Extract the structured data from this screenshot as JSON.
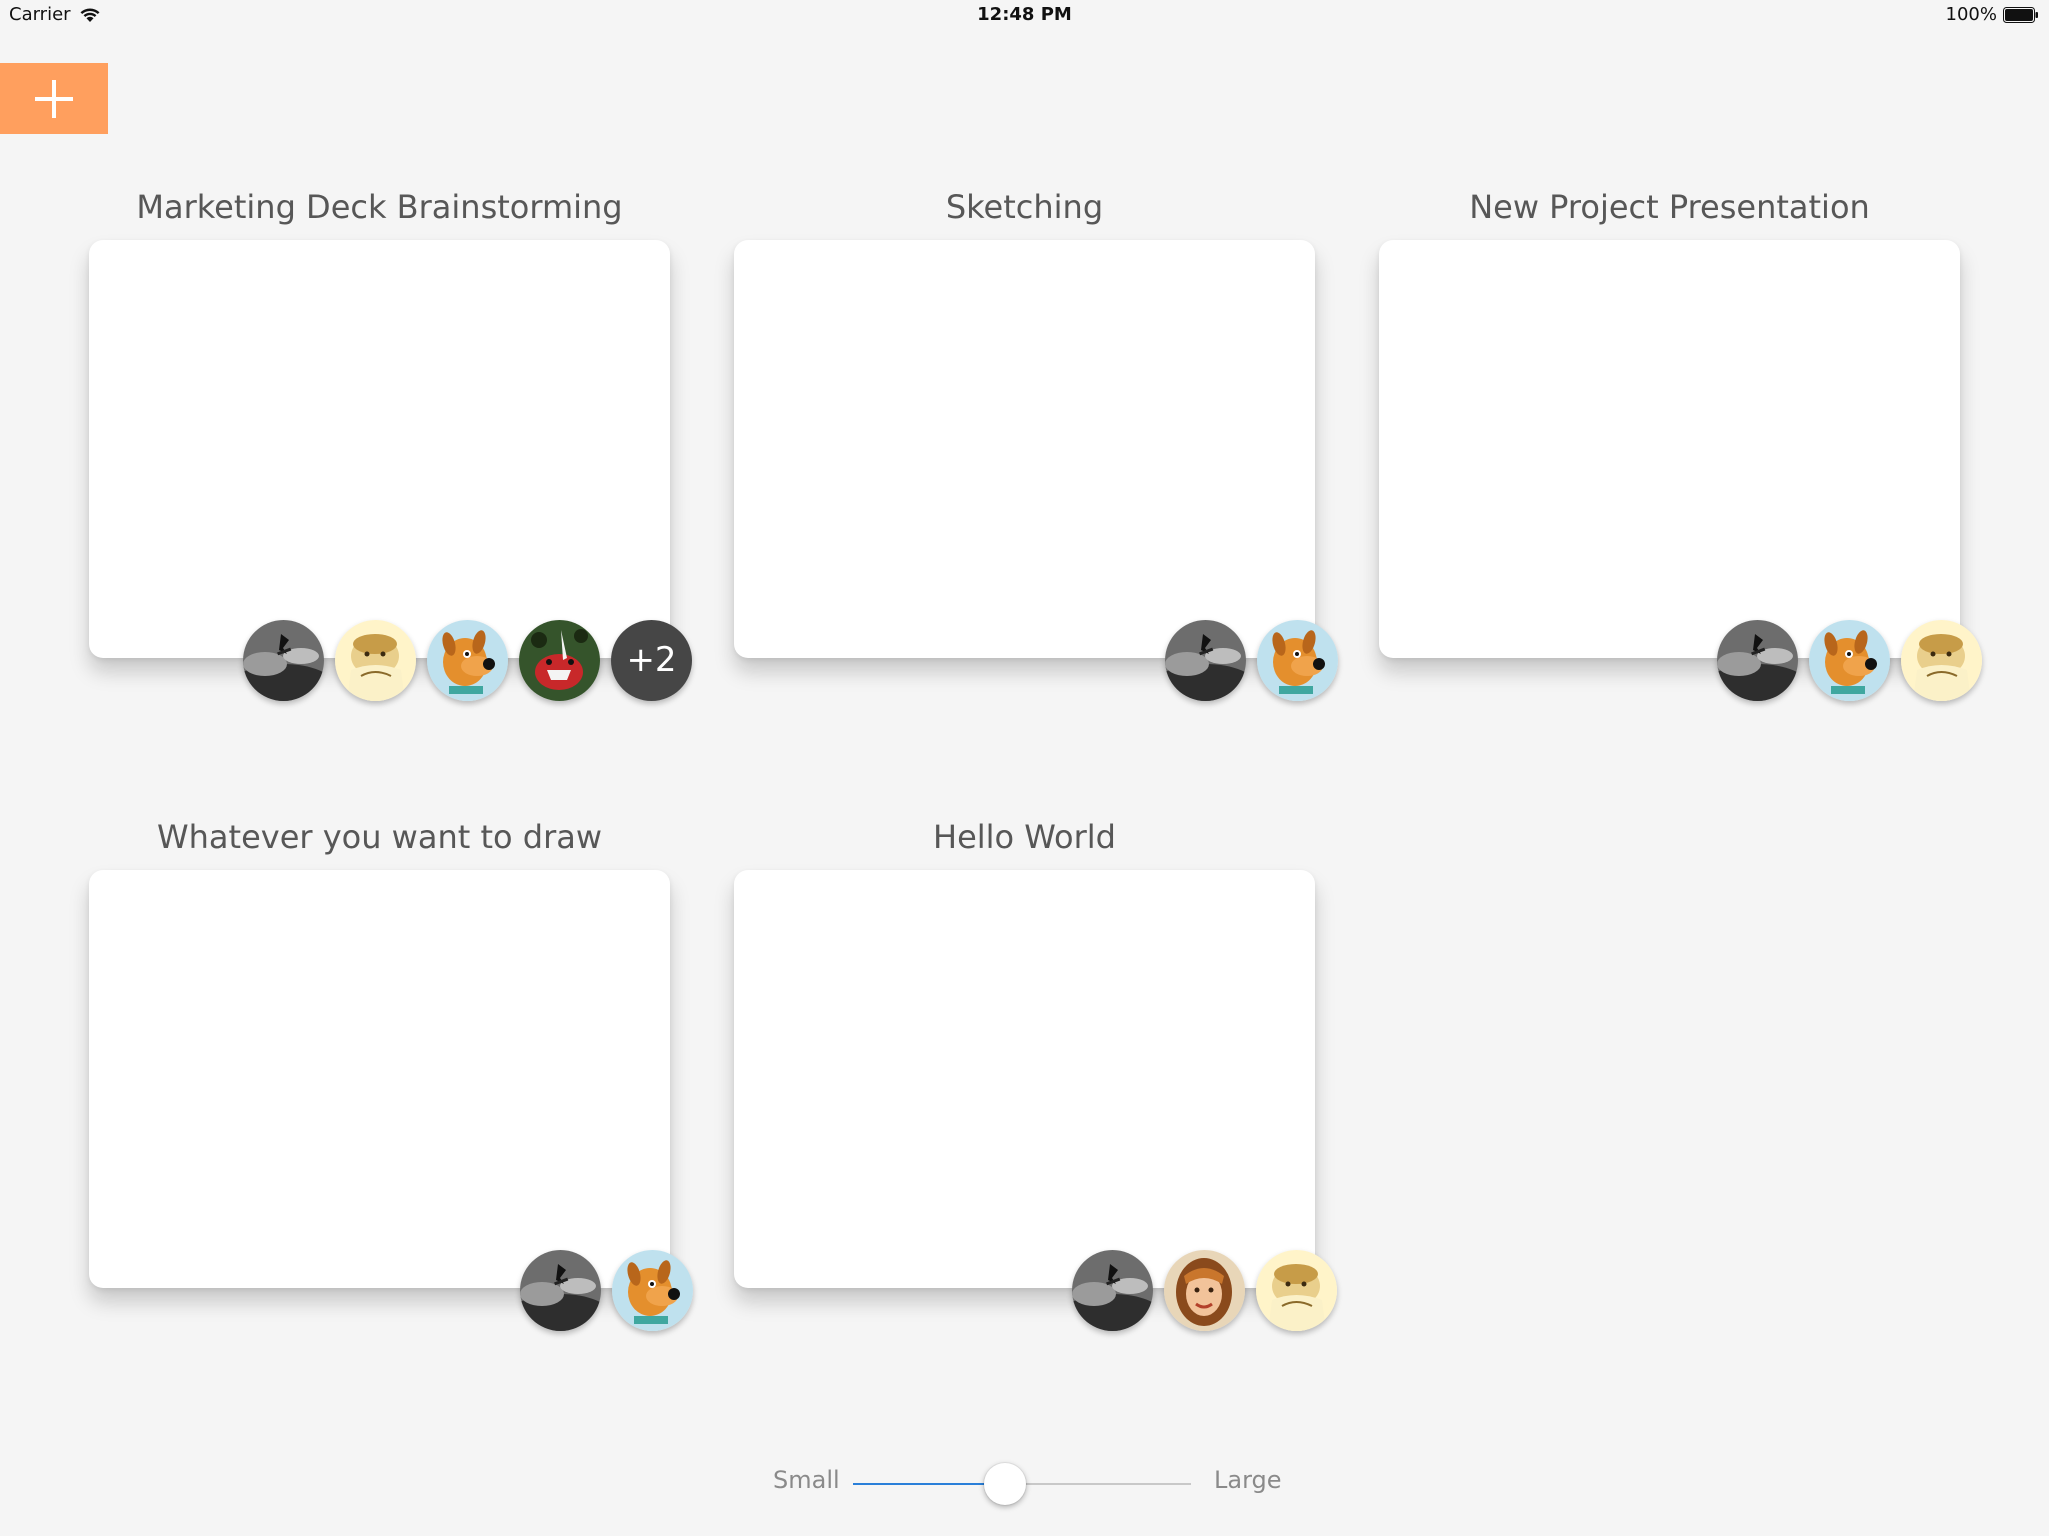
{
  "status_bar": {
    "carrier": "Carrier",
    "time": "12:48 PM",
    "battery": "100%"
  },
  "add_button": {
    "icon": "plus-icon",
    "color": "#ff9f5e"
  },
  "boards": [
    {
      "title": "Marketing Deck Brainstorming",
      "avatars": [
        "surfer-avatar",
        "cartoon-dog-yellow-avatar",
        "scooby-avatar",
        "red-creature-avatar"
      ],
      "more": "+2"
    },
    {
      "title": "Sketching",
      "avatars": [
        "surfer-avatar",
        "scooby-avatar"
      ]
    },
    {
      "title": "New Project Presentation",
      "avatars": [
        "surfer-avatar",
        "scooby-avatar",
        "cartoon-dog-yellow-avatar"
      ]
    },
    {
      "title": "Whatever you want to draw",
      "avatars": [
        "surfer-avatar",
        "scooby-avatar"
      ]
    },
    {
      "title": "Hello World",
      "avatars": [
        "surfer-avatar",
        "girl-avatar",
        "cartoon-dog-yellow-avatar"
      ]
    }
  ],
  "size_slider": {
    "min_label": "Small",
    "max_label": "Large",
    "value": 0.45,
    "fill_color": "#2a7fd9"
  }
}
